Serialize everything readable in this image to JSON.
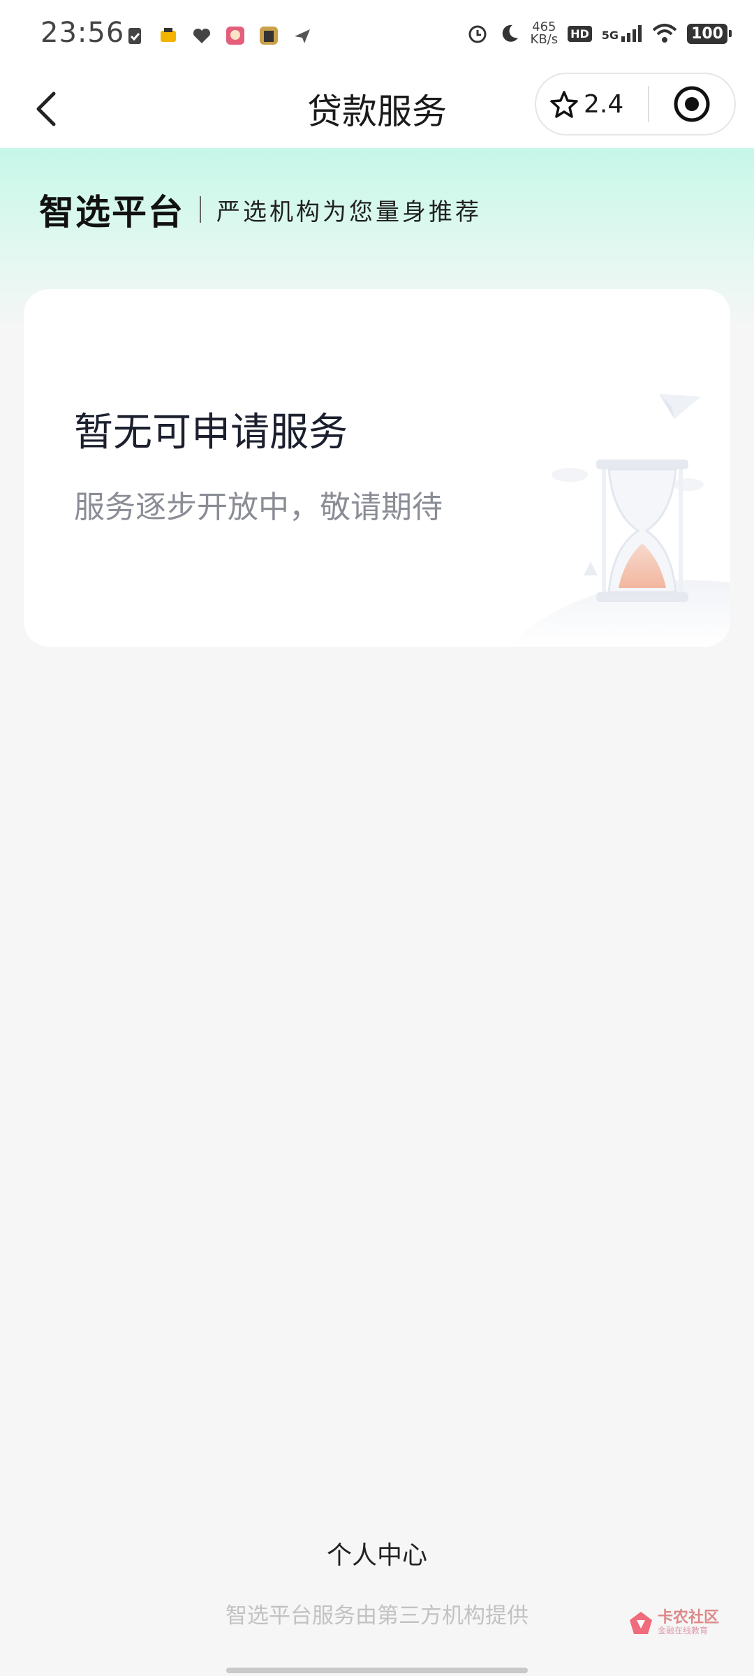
{
  "status_bar": {
    "time": "23:56",
    "net_speed_value": "465",
    "net_speed_unit": "KB/s",
    "hd": "HD",
    "signal": "5G",
    "battery": "100"
  },
  "nav": {
    "title": "贷款服务",
    "rating": "2.4"
  },
  "hero": {
    "brand": "智选平台",
    "tagline": "严选机构为您量身推荐"
  },
  "card": {
    "title": "暂无可申请服务",
    "subtitle": "服务逐步开放中，敬请期待"
  },
  "footer": {
    "link": "个人中心",
    "note": "智选平台服务由第三方机构提供"
  },
  "watermark": {
    "name": "卡农社区",
    "slogan": "金融在线教育"
  },
  "colors": {
    "hero_gradient_top": "#c6f7e8",
    "page_bg": "#f6f6f6",
    "card_title": "#1b1f2e",
    "card_subtitle": "#8b8d96",
    "footer_note": "#c2c2c2"
  },
  "icons": [
    "back-chevron-icon",
    "star-icon",
    "target-icon",
    "hourglass-icon",
    "paper-plane-icon"
  ]
}
